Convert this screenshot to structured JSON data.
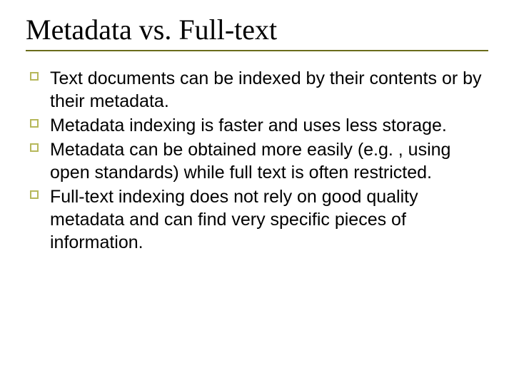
{
  "slide": {
    "title": "Metadata vs. Full-text",
    "bullets": [
      "Text documents can be indexed by their contents or by their metadata.",
      "Metadata indexing is faster and uses less storage.",
      "Metadata can be obtained more easily (e.g. , using open standards) while full text is often restricted.",
      "Full-text indexing does not rely on good quality metadata and can find very specific pieces of information."
    ]
  }
}
